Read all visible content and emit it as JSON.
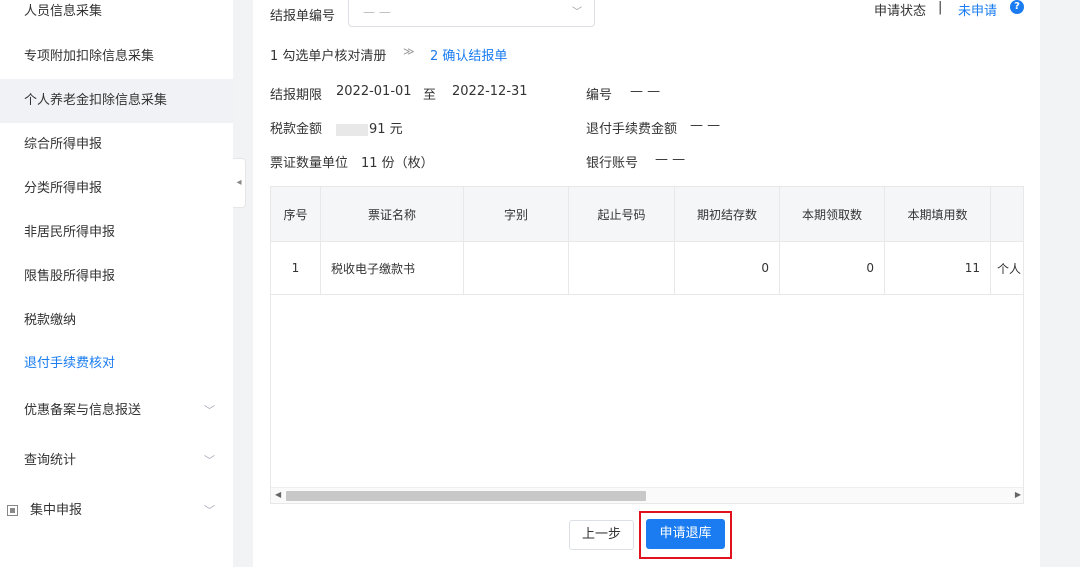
{
  "sidebar": {
    "items": [
      {
        "label": "人员信息采集"
      },
      {
        "label": "专项附加扣除信息采集"
      },
      {
        "label": "个人养老金扣除信息采集"
      },
      {
        "label": "综合所得申报"
      },
      {
        "label": "分类所得申报"
      },
      {
        "label": "非居民所得申报"
      },
      {
        "label": "限售股所得申报"
      },
      {
        "label": "税款缴纳"
      },
      {
        "label": "退付手续费核对"
      },
      {
        "label": "优惠备案与信息报送"
      },
      {
        "label": "查询统计"
      },
      {
        "label": "集中申报"
      }
    ],
    "active_color": "#1a7cf0"
  },
  "form": {
    "settlement_no_label": "结报单编号",
    "settlement_no_placeholder": "— —",
    "apply_status_label": "申请状态",
    "divider": "|",
    "apply_status_value": "未申请",
    "help_icon": "?"
  },
  "steps": {
    "step1": "1 勾选单户核对清册",
    "separator": "≫",
    "step2": "2 确认结报单"
  },
  "info": {
    "period_label": "结报期限",
    "period_start": "2022-01-01",
    "period_to": "至",
    "period_end": "2022-12-31",
    "number_label": "编号",
    "number_value": "— —",
    "tax_amount_label": "税款金额",
    "tax_amount_value": "91 元",
    "refund_fee_label": "退付手续费金额",
    "refund_fee_value": "— —",
    "ticket_qty_label": "票证数量单位",
    "ticket_qty_value": "11 份（枚）",
    "bank_account_label": "银行账号",
    "bank_account_value": "— —"
  },
  "table": {
    "headers": [
      "序号",
      "票证名称",
      "字别",
      "起止号码",
      "期初结存数",
      "本期领取数",
      "本期填用数",
      ""
    ],
    "rows": [
      [
        "1",
        "税收电子缴款书",
        "",
        "",
        "0",
        "0",
        "11",
        "个人"
      ]
    ]
  },
  "buttons": {
    "prev": "上一步",
    "apply": "申请退库"
  },
  "colors": {
    "primary": "#1a7cf0",
    "highlight_frame": "#e0121d"
  }
}
